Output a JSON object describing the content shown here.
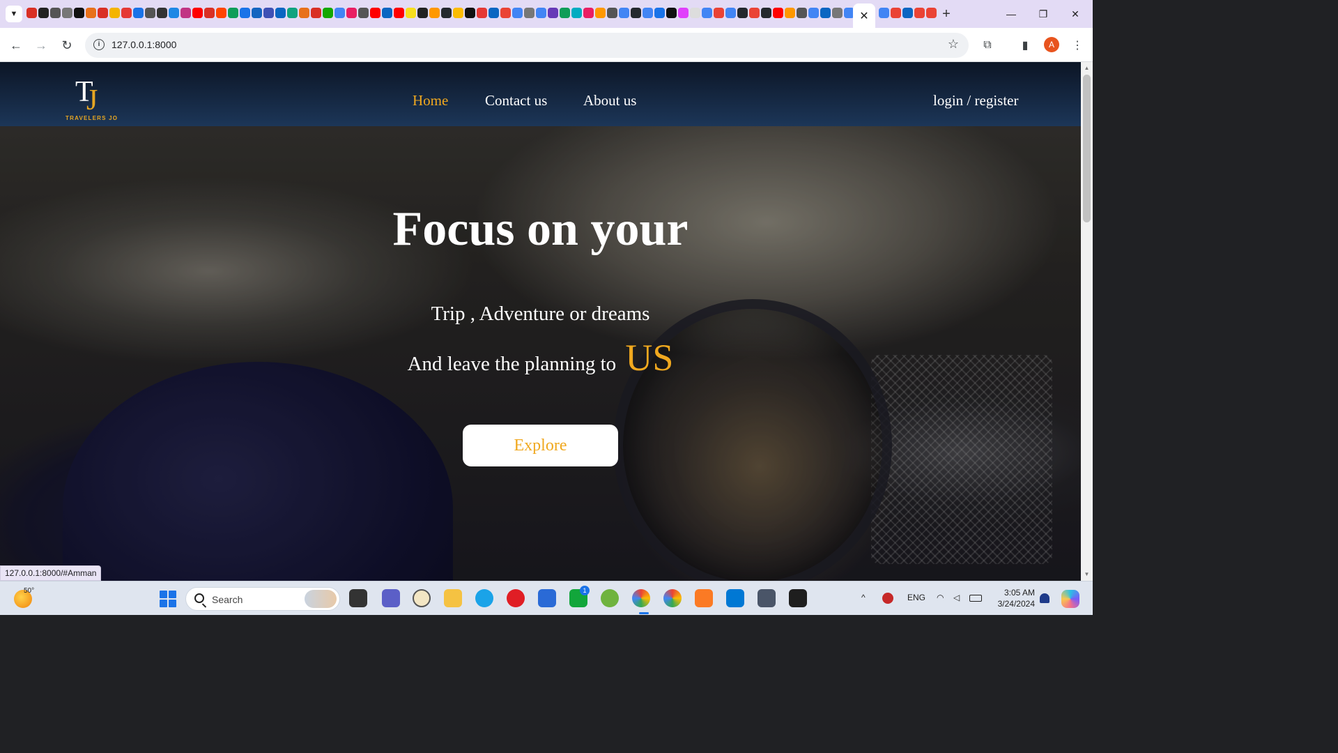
{
  "browser": {
    "url": "127.0.0.1:8000",
    "close_tab_symbol": "✕",
    "status_link": "127.0.0.1:8000/#Amman",
    "profile_initial": "A"
  },
  "site": {
    "logo_letters": "TJ",
    "logo_t": "T",
    "logo_j": "J",
    "logo_caption": "TRAVELERS JO",
    "nav": {
      "home": "Home",
      "contact": "Contact us",
      "about": "About us",
      "auth": "login / register"
    },
    "accent_color": "#f0a81f",
    "hero": {
      "title": "Focus on your",
      "line1": "Trip , Adventure or dreams",
      "line2": "And leave the planning to",
      "highlight": "US",
      "button": "Explore"
    }
  },
  "taskbar": {
    "weather_temp": "50°",
    "search_placeholder": "Search",
    "language": "ENG",
    "time": "3:05 AM",
    "date": "3/24/2024",
    "badge_count": "1"
  }
}
